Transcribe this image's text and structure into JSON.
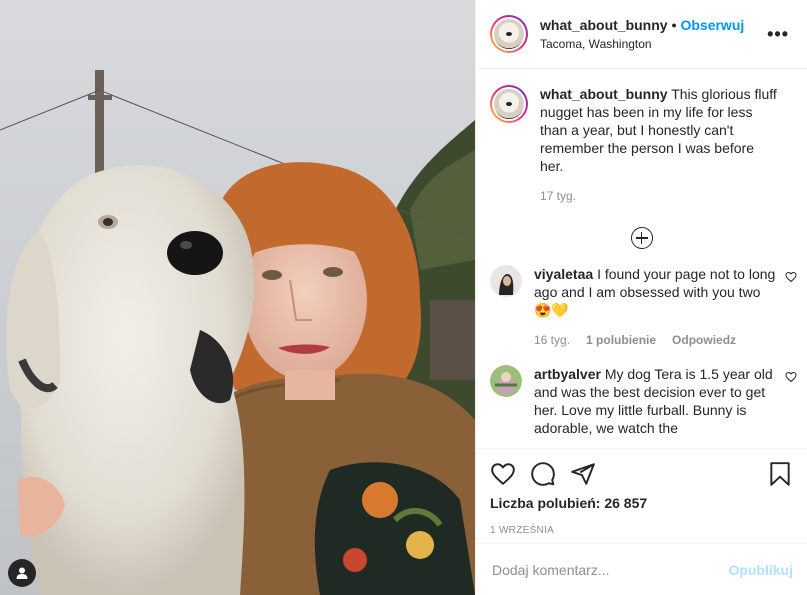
{
  "post": {
    "username": "what_about_bunny",
    "follow_label": "Obserwuj",
    "dot": "•",
    "location": "Tacoma, Washington",
    "more": "•••",
    "caption": "This glorious fluff nugget has been in my life for less than a year, but I honestly can't remember the person I was before her.",
    "caption_time": "17 tyg."
  },
  "comments": [
    {
      "username": "viyaletaa",
      "text": "I found your page not to long ago and I am obsessed with you two 😍💛",
      "time": "16 tyg.",
      "likes": "1 polubienie",
      "reply": "Odpowiedz"
    },
    {
      "username": "artbyalver",
      "text": "My dog Tera is 1.5 year old and was the best decision ever to get her. Love my little furball. Bunny is adorable, we watch the"
    }
  ],
  "likes_text": "Liczba polubień: 26 857",
  "date": "1 WRZEŚNIA",
  "add_comment": {
    "placeholder": "Dodaj komentarz...",
    "post_label": "Opublikuj"
  },
  "colors": {
    "accent": "#0095f6",
    "muted": "#8e8e8e",
    "post_disabled": "#b2dffc"
  }
}
